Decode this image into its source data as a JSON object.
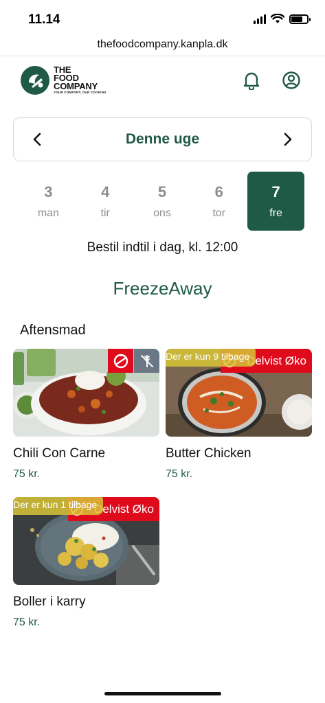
{
  "status_bar": {
    "time": "11.14"
  },
  "browser": {
    "url": "thefoodcompany.kanpla.dk"
  },
  "header": {
    "logo_name_lines": [
      "THE",
      "FOOD",
      "COMPANY"
    ],
    "logo_tagline": "YOUR COMFORT, OUR COOKING",
    "icons": [
      "bell-icon",
      "user-circle-icon"
    ]
  },
  "week": {
    "title": "Denne uge"
  },
  "days": [
    {
      "num": "3",
      "name": "man",
      "active": false
    },
    {
      "num": "4",
      "name": "tir",
      "active": false
    },
    {
      "num": "5",
      "name": "ons",
      "active": false
    },
    {
      "num": "6",
      "name": "tor",
      "active": false
    },
    {
      "num": "7",
      "name": "fre",
      "active": true
    }
  ],
  "deadline": "Bestil indtil i dag, kl. 12:00",
  "shop_title": "FreezeAway",
  "category": "Aftensmad",
  "products": [
    {
      "name": "Chili Con Carne",
      "price": "75 kr.",
      "badges": [
        "organic-label-icon",
        "no-gluten-icon"
      ]
    },
    {
      "name": "Butter Chicken",
      "price": "75 kr.",
      "badge_label": "Delvist Øko",
      "stock_note": "Der er kun 9 tilbage"
    },
    {
      "name": "Boller i karry",
      "price": "75 kr.",
      "badge_label": "Delvist Øko",
      "stock_note": "Der er kun 1 tilbage"
    }
  ],
  "colors": {
    "brand_green": "#1f5a46",
    "organic_red": "#df0b1c",
    "stock_yellow": "#d8c437",
    "muted_day": "#8d8d8d"
  }
}
